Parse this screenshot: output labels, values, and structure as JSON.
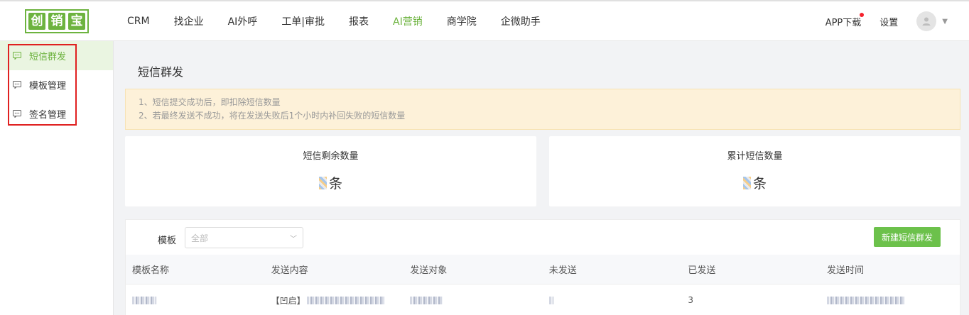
{
  "logo": {
    "chars": [
      "创",
      "销",
      "宝"
    ]
  },
  "nav": [
    {
      "label": "CRM",
      "active": false
    },
    {
      "label": "找企业",
      "active": false
    },
    {
      "label": "AI外呼",
      "active": false
    },
    {
      "label": "工单|审批",
      "active": false
    },
    {
      "label": "报表",
      "active": false
    },
    {
      "label": "AI营销",
      "active": true
    },
    {
      "label": "商学院",
      "active": false
    },
    {
      "label": "企微助手",
      "active": false
    }
  ],
  "topright": {
    "app_download": "APP下载",
    "settings": "设置"
  },
  "sidebar": {
    "items": [
      {
        "label": "短信群发",
        "active": true
      },
      {
        "label": "模板管理",
        "active": false
      },
      {
        "label": "签名管理",
        "active": false
      }
    ]
  },
  "page": {
    "title": "短信群发",
    "notice": [
      "1、短信提交成功后，即扣除短信数量",
      "2、若最终发送不成功，将在发送失败后1个小时内补回失败的短信数量"
    ]
  },
  "stats": {
    "remaining_label": "短信剩余数量",
    "remaining_unit": "条",
    "total_label": "累计短信数量",
    "total_unit": "条"
  },
  "filter": {
    "label": "模板",
    "placeholder": "全部"
  },
  "new_button": "新建短信群发",
  "table": {
    "headers": [
      "模板名称",
      "发送内容",
      "发送对象",
      "未发送",
      "已发送",
      "发送时间"
    ],
    "rows": [
      {
        "content_prefix": "【凹启】",
        "sent": "3"
      }
    ]
  },
  "colors": {
    "accent": "#6db33f",
    "button": "#6cc14b",
    "highlight_box": "#e02020",
    "notice_bg": "#fdf1d9"
  }
}
